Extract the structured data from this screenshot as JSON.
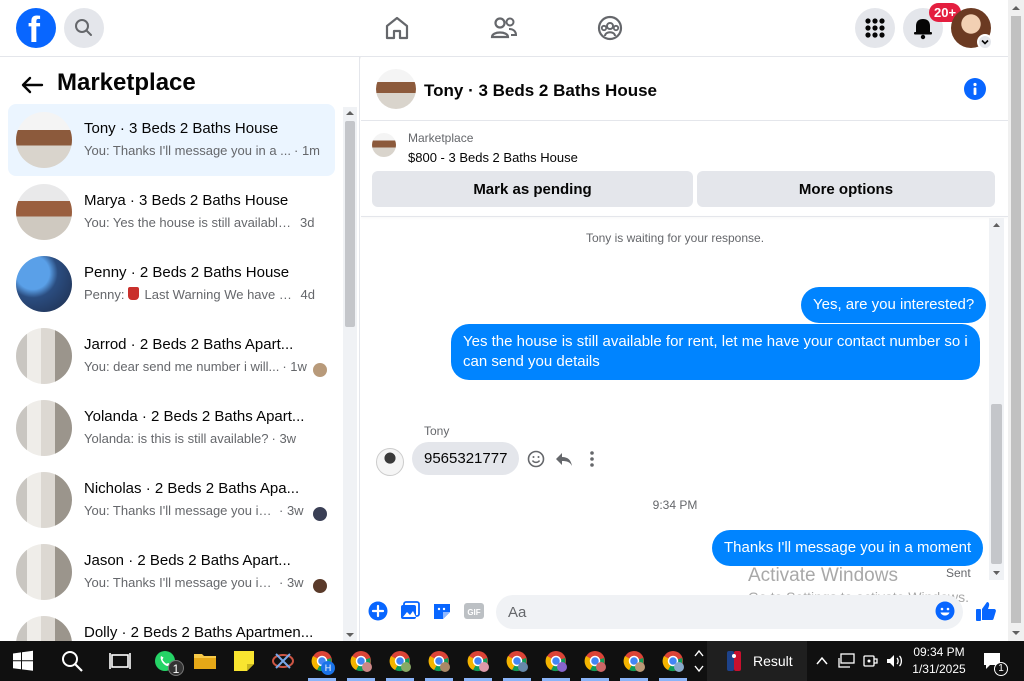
{
  "colors": {
    "accent": "#0866ff",
    "bubble_out": "#0084ff",
    "badge": "#e41e3f"
  },
  "topbar": {
    "logo_icon": "facebook-logo-icon",
    "icons": [
      "search-icon",
      "home-icon",
      "friends-icon",
      "groups-icon",
      "menu-grid-icon",
      "bell-icon"
    ],
    "notification_count": "20+"
  },
  "sidebar": {
    "title": "Marketplace",
    "conversations": [
      {
        "name": "Tony · 3 Beds 2 Baths House",
        "preview": "You: Thanks I'll message you in a ...",
        "time": "· 1m",
        "active": true
      },
      {
        "name": "Marya · 3 Beds 2 Baths House",
        "preview": "You: Yes the house is still available ...",
        "time": "3d"
      },
      {
        "name": "Penny · 2 Beds 2 Baths House",
        "preview_prefix": "Penny:",
        "preview": "Last Warning We have d...",
        "time": "4d"
      },
      {
        "name": "Jarrod · 2 Beds 2 Baths Apart...",
        "preview": "You: dear send me number i will...",
        "time": "· 1w"
      },
      {
        "name": "Yolanda · 2 Beds 2 Baths Apart...",
        "preview": "Yolanda: is this is still available?",
        "time": "· 3w"
      },
      {
        "name": "Nicholas · 2 Beds 2 Baths Apa...",
        "preview": "You: Thanks I'll message you in ...",
        "time": "· 3w"
      },
      {
        "name": "Jason · 2 Beds 2 Baths Apart...",
        "preview": "You: Thanks I'll message you in ...",
        "time": "· 3w"
      },
      {
        "name": "Dolly · 2 Beds 2 Baths Apartmen...",
        "preview": "",
        "time": ""
      }
    ]
  },
  "chat": {
    "title": "Tony · 3 Beds 2 Baths House",
    "marketplace_label": "Marketplace",
    "listing": "$800 - 3 Beds 2 Baths House",
    "pending_button": "Mark as pending",
    "options_button": "More options",
    "waiting_notice": "Tony is waiting for your response.",
    "messages": {
      "out1": "Yes, are you interested?",
      "out2": "Yes the house is still available for rent, let me have your contact number so i can send you details",
      "in_sender": "Tony",
      "in1": "9565321777",
      "timestamp": "9:34 PM",
      "out3": "Thanks I'll message you in a moment",
      "status": "Sent"
    },
    "composer_placeholder": "Aa",
    "watermark_title": "Activate Windows",
    "watermark_sub": "Go to Settings to activate Windows."
  },
  "taskbar": {
    "whatsapp_badge": "1",
    "chrome_letter": "H",
    "result_label": "Result",
    "time": "09:34 PM",
    "date": "1/31/2025",
    "notif_count": "1"
  }
}
